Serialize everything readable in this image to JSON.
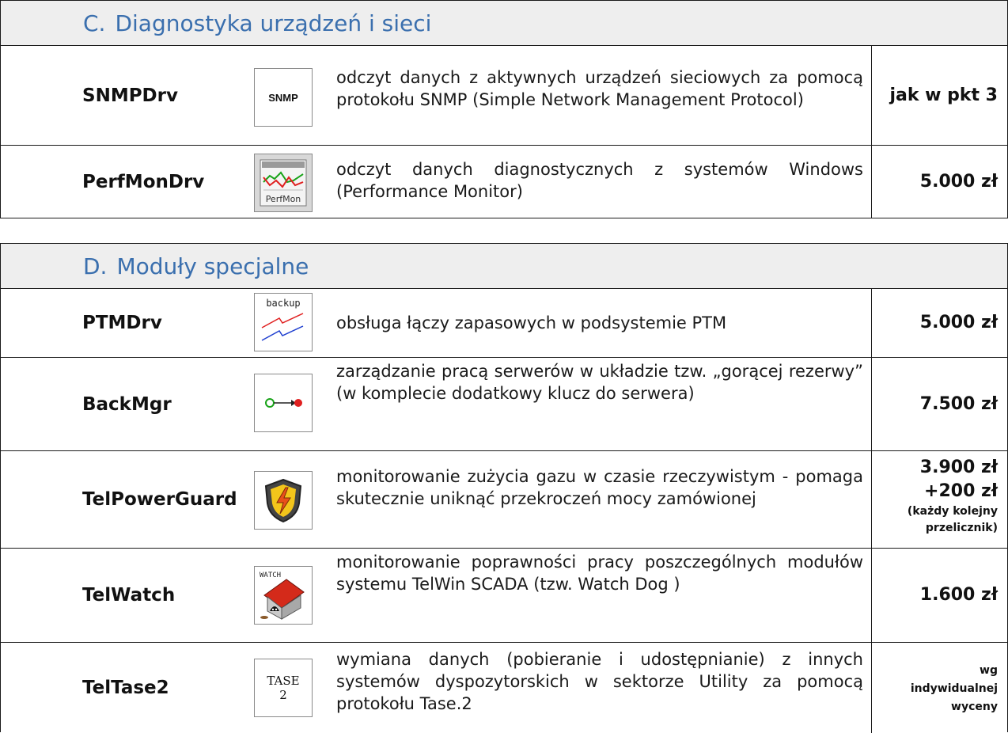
{
  "section_c": {
    "number": "C.",
    "title": "Diagnostyka urządzeń i sieci",
    "rows": [
      {
        "name": "SNMPDrv",
        "icon": "snmp-icon",
        "icon_text": "SNMP",
        "description": "odczyt danych z aktywnych urządzeń sieciowych za pomocą protokołu SNMP (Simple Network Management  Protocol)",
        "price": "jak w pkt 3"
      },
      {
        "name": "PerfMonDrv",
        "icon": "perfmon-icon",
        "icon_text": "PerfMon",
        "description": "odczyt danych diagnostycznych z systemów Windows (Performance Monitor)",
        "price": "5.000 zł"
      }
    ]
  },
  "section_d": {
    "number": "D.",
    "title": "Moduły specjalne",
    "rows": [
      {
        "name": "PTMDrv",
        "icon": "backup-link-icon",
        "icon_text": "backup",
        "description": "obsługa łączy zapasowych w podsystemie PTM",
        "price": "5.000 zł"
      },
      {
        "name": "BackMgr",
        "icon": "hot-standby-icon",
        "description": "zarządzanie pracą serwerów w układzie tzw. „gorącej rezerwy” (w komplecie dodatkowy klucz do serwera)",
        "price": "7.500 zł"
      },
      {
        "name": "TelPowerGuard",
        "icon": "power-shield-icon",
        "description": "monitorowanie zużycia gazu w czasie rzeczywistym - pomaga skutecznie uniknąć przekroczeń mocy zamówionej",
        "price": "3.900 zł",
        "price_extra": "+200 zł",
        "price_note": "(każdy kolejny przelicznik)"
      },
      {
        "name": "TelWatch",
        "icon": "watchdog-icon",
        "icon_text": "WATCH",
        "description": "monitorowanie poprawności pracy poszczególnych modułów systemu TelWin SCADA (tzw. Watch Dog )",
        "price": "1.600 zł"
      },
      {
        "name": "TelTase2",
        "icon": "tase2-icon",
        "icon_text_1": "TASE",
        "icon_text_2": "2",
        "description": "wymiana danych (pobieranie i udostępnianie) z innych systemów dyspozytorskich w sektorze Utility za pomocą protokołu Tase.2",
        "price_1": "wg",
        "price_2": "indywidualnej",
        "price_3": "wyceny"
      }
    ]
  }
}
